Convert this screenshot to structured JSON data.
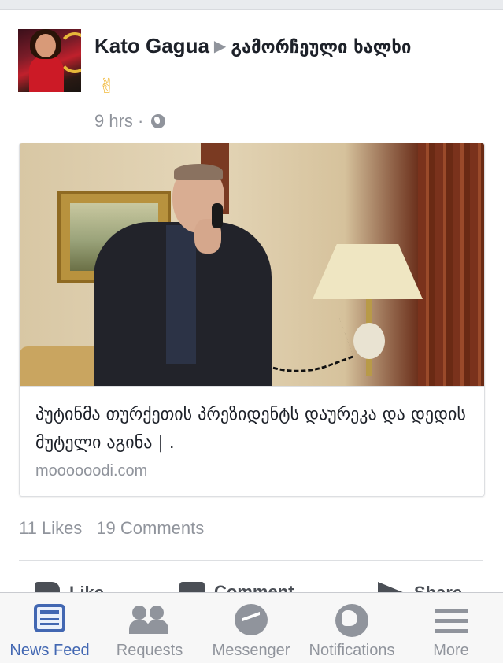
{
  "post": {
    "author": "Kato Gagua",
    "group": "გამორჩეული ხალხი",
    "emoji": "✌",
    "time": "9 hrs ·",
    "link": {
      "title": "პუტინმა თურქეთის პრეზიდენტს დაურეკა და დედის მუტელი აგინა | .",
      "domain": "moooooodi.com"
    },
    "likes": "11 Likes",
    "comments": "19 Comments",
    "actions": {
      "like": "Like",
      "comment": "Comment",
      "share": "Share"
    }
  },
  "tabbar": {
    "items": [
      {
        "label": "News Feed",
        "icon": "news-feed-icon",
        "active": true
      },
      {
        "label": "Requests",
        "icon": "friend-requests-icon"
      },
      {
        "label": "Messenger",
        "icon": "messenger-icon"
      },
      {
        "label": "Notifications",
        "icon": "globe-icon"
      },
      {
        "label": "More",
        "icon": "hamburger-menu-icon"
      }
    ],
    "active_color": "#4267b2",
    "inactive_color": "#90949c"
  }
}
